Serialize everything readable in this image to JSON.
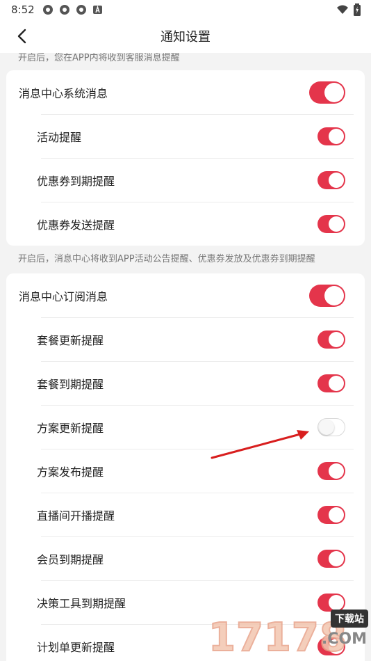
{
  "status": {
    "time": "8:52"
  },
  "header": {
    "title": "通知设置"
  },
  "hints": {
    "service": "开启后，您在APP内将收到客服消息提醒",
    "system": "开启后，消息中心将收到APP活动公告提醒、优惠券发放及优惠券到期提醒"
  },
  "system_group": {
    "main": {
      "label": "消息中心系统消息",
      "on": true
    },
    "items": [
      {
        "label": "活动提醒",
        "on": true
      },
      {
        "label": "优惠券到期提醒",
        "on": true
      },
      {
        "label": "优惠券发送提醒",
        "on": true
      }
    ]
  },
  "subscribe_group": {
    "main": {
      "label": "消息中心订阅消息",
      "on": true
    },
    "items": [
      {
        "label": "套餐更新提醒",
        "on": true
      },
      {
        "label": "套餐到期提醒",
        "on": true
      },
      {
        "label": "方案更新提醒",
        "on": false
      },
      {
        "label": "方案发布提醒",
        "on": true
      },
      {
        "label": "直播间开播提醒",
        "on": true
      },
      {
        "label": "会员到期提醒",
        "on": true
      },
      {
        "label": "决策工具到期提醒",
        "on": true
      },
      {
        "label": "计划单更新提醒",
        "on": true
      }
    ]
  },
  "watermark": {
    "digits": "17178",
    "badge": "下载站",
    "suffix": ".COM"
  },
  "colors": {
    "accent": "#e4354b",
    "annotation": "#d81e1e"
  }
}
